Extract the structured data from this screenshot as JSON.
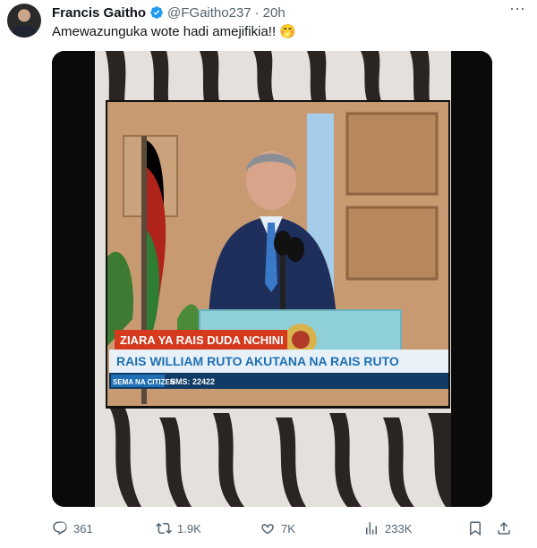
{
  "tweet": {
    "author_name": "Francis Gaitho",
    "handle": "@FGaitho237",
    "separator": "·",
    "time": "20h",
    "text": "Amewazunguka wote hadi amejifikia!! 🤭",
    "more_label": "···"
  },
  "media": {
    "tv_banner": "ZIARA YA RAIS DUDA NCHINI",
    "tv_headline": "RAIS WILLIAM RUTO AKUTANA NA RAIS RUTO",
    "tv_footer_left": "SEMA NA CITIZEN",
    "tv_footer_right": "SMS: 22422"
  },
  "actions": {
    "replies": "361",
    "retweets": "1.9K",
    "likes": "7K",
    "views": "233K"
  },
  "colors": {
    "verified": "#1d9bf0",
    "text_secondary": "#536471",
    "tv_banner_red": "#d63a1e",
    "tv_headline_blue": "#1e6fb3"
  }
}
